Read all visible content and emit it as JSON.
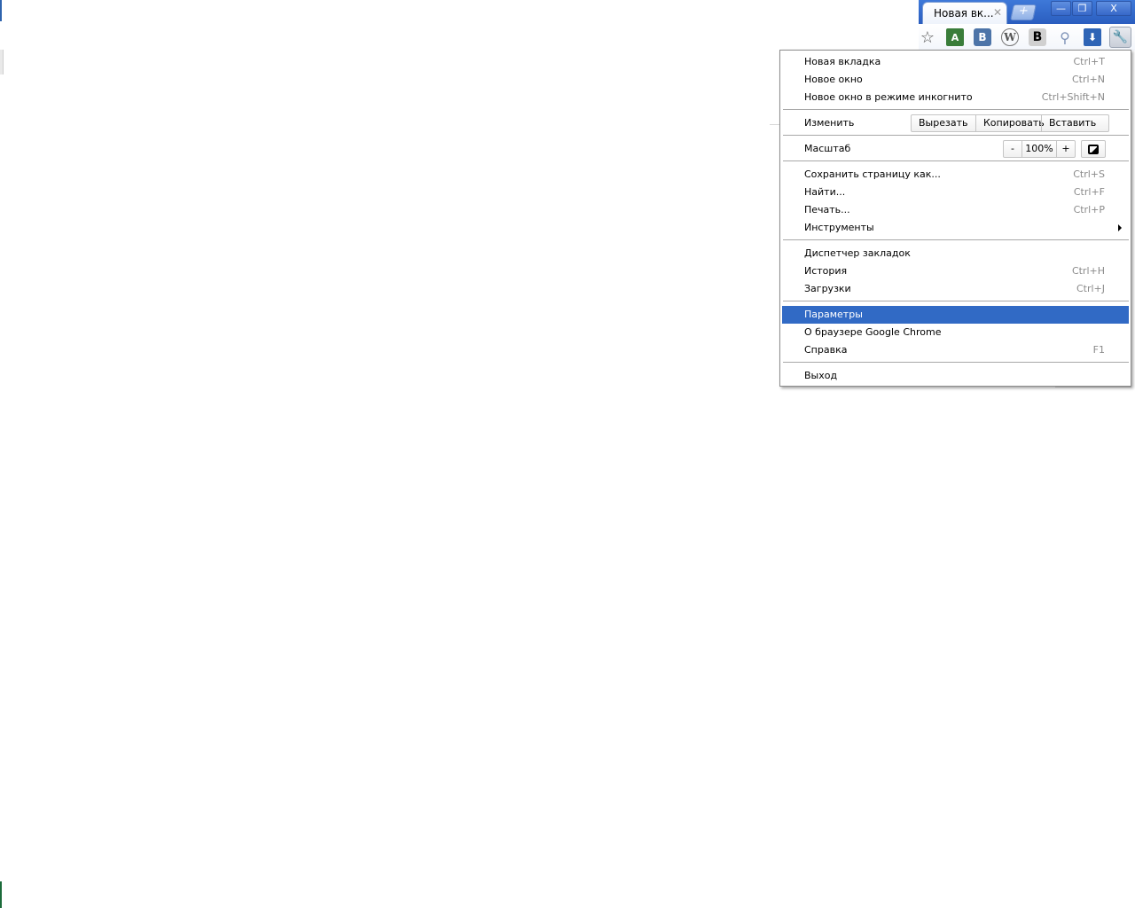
{
  "tab": {
    "title": "Новая вк...",
    "close": "✕",
    "new_tab": "+"
  },
  "window_controls": {
    "minimize": "—",
    "maximize": "❐",
    "close": "X"
  },
  "toolbar": {
    "star": "☆",
    "translate": "A",
    "vk": "B",
    "wiki": "W",
    "b_ext": "B",
    "search": "⚲",
    "download": "⬇",
    "wrench": "🔧"
  },
  "menu": {
    "new_tab": {
      "label": "Новая вкладка",
      "accel": "Ctrl+T"
    },
    "new_window": {
      "label": "Новое окно",
      "accel": "Ctrl+N"
    },
    "incognito": {
      "label": "Новое окно в режиме инкогнито",
      "accel": "Ctrl+Shift+N"
    },
    "edit": {
      "label": "Изменить",
      "cut": "Вырезать",
      "copy": "Копировать",
      "paste": "Вставить"
    },
    "zoom": {
      "label": "Масштаб",
      "minus": "-",
      "value": "100%",
      "plus": "+"
    },
    "save_page": {
      "label": "Сохранить страницу как...",
      "accel": "Ctrl+S"
    },
    "find": {
      "label": "Найти...",
      "accel": "Ctrl+F"
    },
    "print": {
      "label": "Печать...",
      "accel": "Ctrl+P"
    },
    "tools": {
      "label": "Инструменты"
    },
    "bookmarks_manager": {
      "label": "Диспетчер закладок"
    },
    "history": {
      "label": "История",
      "accel": "Ctrl+H"
    },
    "downloads": {
      "label": "Загрузки",
      "accel": "Ctrl+J"
    },
    "settings": {
      "label": "Параметры"
    },
    "about": {
      "label": "О браузере Google Chrome"
    },
    "help": {
      "label": "Справка",
      "accel": "F1"
    },
    "exit": {
      "label": "Выход"
    }
  },
  "colors": {
    "selection": "#316ac5",
    "titlebar": "#2a5dbf"
  }
}
